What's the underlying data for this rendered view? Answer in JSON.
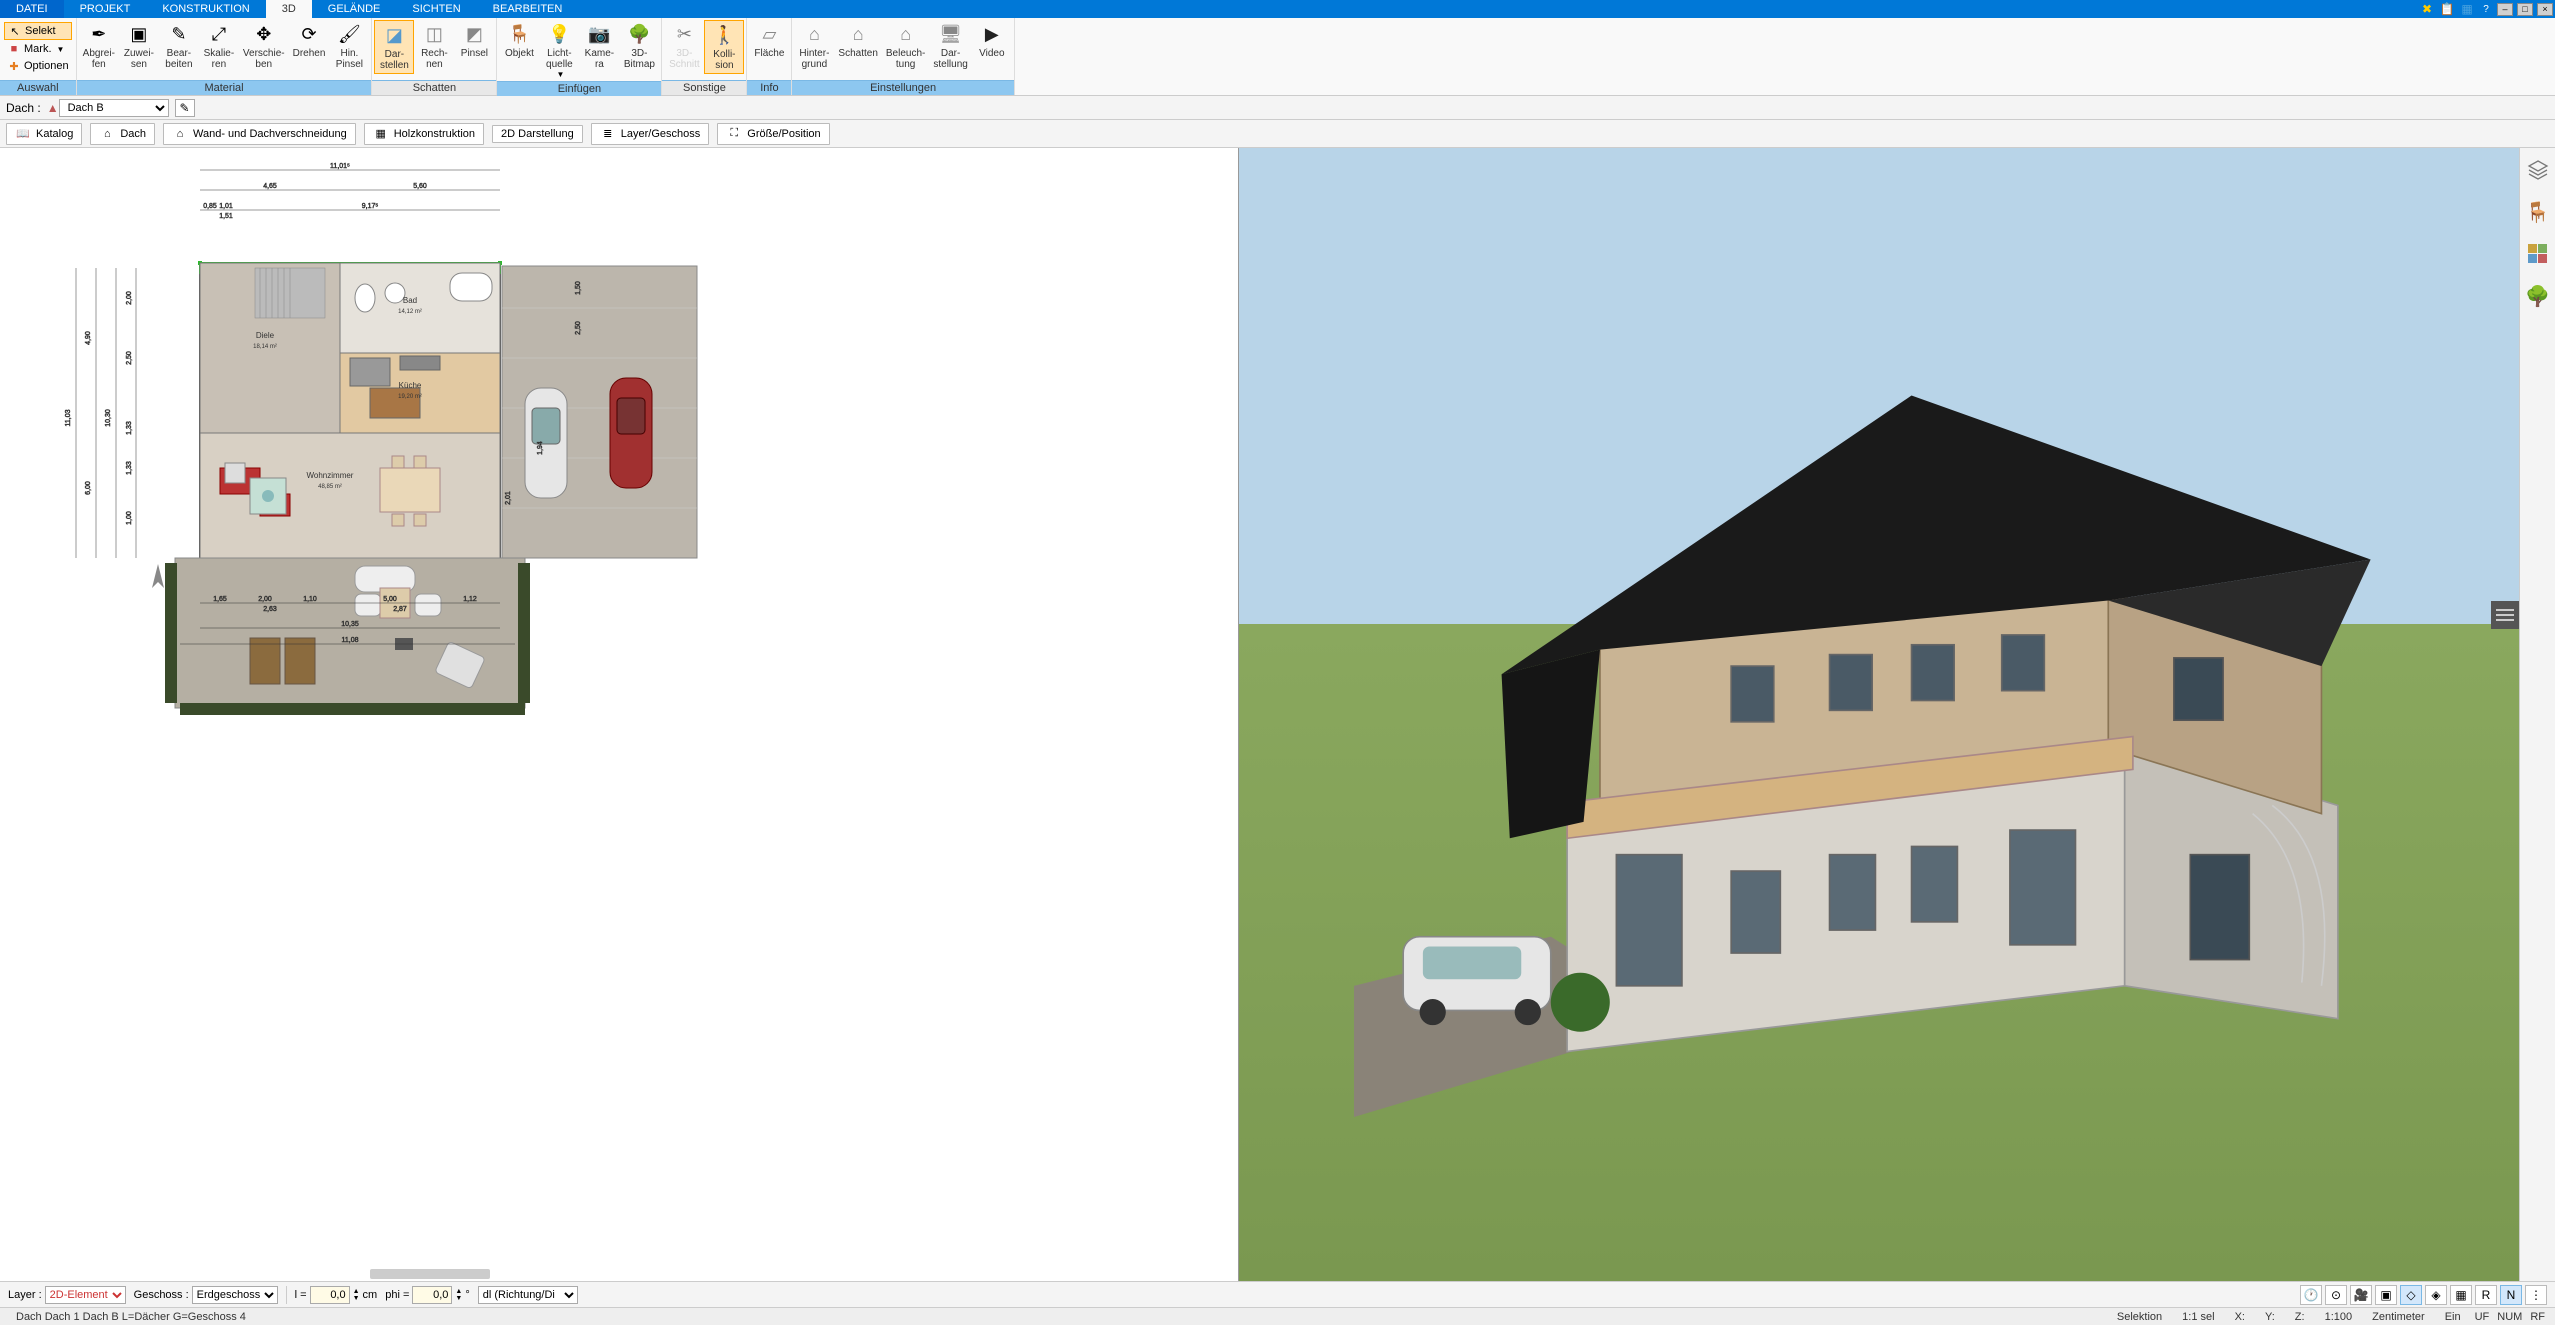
{
  "tabs": {
    "datei": "DATEI",
    "projekt": "PROJEKT",
    "konstruktion": "KONSTRUKTION",
    "three_d": "3D",
    "gelaende": "GELÄNDE",
    "sichten": "SICHTEN",
    "bearbeiten": "BEARBEITEN"
  },
  "ribbon": {
    "auswahl": {
      "selekt": "Selekt",
      "mark": "Mark.",
      "optionen": "Optionen",
      "label": "Auswahl"
    },
    "material": {
      "abgreifen": "Abgrei-\nfen",
      "zuweisen": "Zuwei-\nsen",
      "bearbeiten": "Bear-\nbeiten",
      "skalieren": "Skalie-\nren",
      "verschieben": "Verschie-\nben",
      "drehen": "Drehen",
      "hinpinsel": "Hin.\nPinsel",
      "label": "Material"
    },
    "schatten": {
      "darstellen": "Dar-\nstellen",
      "rechnen": "Rech-\nnen",
      "pinsel": "Pinsel",
      "label": "Schatten"
    },
    "einfuegen": {
      "objekt": "Objekt",
      "lichtquelle": "Licht-\nquelle",
      "kamera": "Kame-\nra",
      "bitmap3d": "3D-\nBitmap",
      "label": "Einfügen"
    },
    "sonstige": {
      "schnitt3d": "3D-\nSchnitt",
      "kollision": "Kolli-\nsion",
      "label": "Sonstige"
    },
    "info": {
      "flaeche": "Fläche",
      "label": "Info"
    },
    "einstellungen": {
      "hintergrund": "Hinter-\ngrund",
      "schatten": "Schatten",
      "beleuchtung": "Beleuch-\ntung",
      "darstellung": "Dar-\nstellung",
      "video": "Video",
      "label": "Einstellungen"
    }
  },
  "subbar": {
    "dach_label": "Dach :",
    "dach_value": "Dach B"
  },
  "ctx": {
    "katalog": "Katalog",
    "dach": "Dach",
    "wandDach": "Wand- und Dachverschneidung",
    "holz": "Holzkonstruktion",
    "darst2d": "2D Darstellung",
    "layerGeschoss": "Layer/Geschoss",
    "groessePos": "Größe/Position"
  },
  "plan": {
    "rooms": {
      "bad": "Bad",
      "bad_area": "14,12 m²",
      "diele": "Diele",
      "diele_area": "18,14 m²",
      "kueche": "Küche",
      "kueche_area": "19,20 m²",
      "wohn": "Wohnzimmer",
      "wohn_area": "48,85 m²"
    },
    "dim_top1": "11,01⁵",
    "dim_top2a": "4,65",
    "dim_top2b": "5,60",
    "dim_top3a": "0,85",
    "dim_top3a2": "1,01",
    "dim_top3b": "9,17⁵",
    "dim_top3c": "1,51",
    "dim_left_all": "11,03",
    "dim_left_up": "4,90",
    "dim_left_lo": "6,00",
    "dim_left_s1": "2,00",
    "dim_left_s2": "2,50",
    "dim_left_s3": "1,33",
    "dim_left_s4": "1,33",
    "dim_left_s5": "1,00",
    "dim_left_r": "10,30",
    "dim_bot1": "1,65",
    "dim_bot2": "2,00",
    "dim_bot3": "1,10",
    "dim_bot4": "5,00",
    "dim_bot5": "1,12",
    "dim_bot2b": "2,63",
    "dim_bot4b": "2,87",
    "dim_bot_w": "10,35",
    "dim_bot_w2": "11,08",
    "dim_r1": "1,94",
    "dim_r2": "2,01",
    "dim_r3": "2,50",
    "dim_r4": "1,50"
  },
  "btm": {
    "layer_label": "Layer :",
    "layer_value": "2D-Element",
    "geschoss_label": "Geschoss :",
    "geschoss_value": "Erdgeschoss",
    "l_label": "l =",
    "l_value": "0,0",
    "cm": "cm",
    "phi_label": "phi =",
    "phi_value": "0,0",
    "deg": "°",
    "dl": "dl (Richtung/Di"
  },
  "status": {
    "left": "Dach Dach 1 Dach B L=Dächer G=Geschoss 4",
    "selektion": "Selektion",
    "sel": "1:1 sel",
    "x": "X:",
    "y": "Y:",
    "z": "Z:",
    "scale": "1:100",
    "unit": "Zentimeter",
    "ein": "Ein",
    "uf": "UF",
    "num": "NUM",
    "rf": "RF"
  }
}
